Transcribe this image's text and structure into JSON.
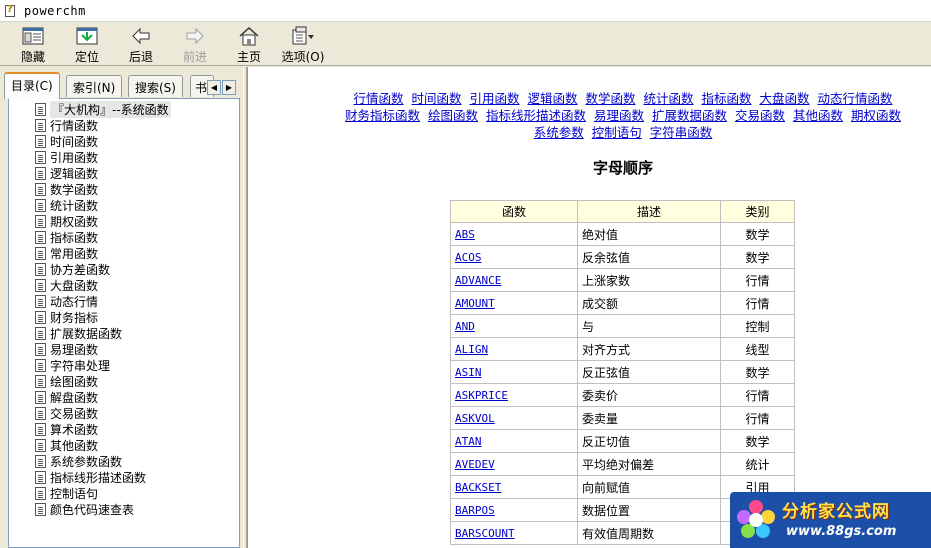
{
  "window": {
    "title": "powerchm"
  },
  "toolbar": {
    "buttons": [
      {
        "label": "隐藏",
        "icon": "hide-icon"
      },
      {
        "label": "定位",
        "icon": "locate-icon"
      },
      {
        "label": "后退",
        "icon": "back-arrow-icon"
      },
      {
        "label": "前进",
        "icon": "forward-arrow-icon",
        "disabled": true
      },
      {
        "label": "主页",
        "icon": "home-icon"
      },
      {
        "label": "选项(O)",
        "icon": "options-icon"
      }
    ]
  },
  "tabs": [
    {
      "label": "目录(C)",
      "active": true
    },
    {
      "label": "索引(N)"
    },
    {
      "label": "搜索(S)"
    },
    {
      "label": "书"
    }
  ],
  "tree": {
    "items": [
      "『大机构』--系统函数",
      "行情函数",
      "时间函数",
      "引用函数",
      "逻辑函数",
      "数学函数",
      "统计函数",
      "期权函数",
      "指标函数",
      "常用函数",
      "协方差函数",
      "大盘函数",
      "动态行情",
      "财务指标",
      "扩展数据函数",
      "易理函数",
      "字符串处理",
      "绘图函数",
      "解盘函数",
      "交易函数",
      "算术函数",
      "其他函数",
      "系统参数函数",
      "指标线形描述函数",
      "控制语句",
      "颜色代码速查表"
    ]
  },
  "content": {
    "category_links": [
      "行情函数",
      "时间函数",
      "引用函数",
      "逻辑函数",
      "数学函数",
      "统计函数",
      "指标函数",
      "大盘函数",
      "动态行情函数",
      "财务指标函数",
      "绘图函数",
      "指标线形描述函数",
      "易理函数",
      "扩展数据函数",
      "交易函数",
      "其他函数",
      "期权函数",
      "系统参数",
      "控制语句",
      "字符串函数"
    ],
    "heading": "字母顺序",
    "table": {
      "headers": [
        "函数",
        "描述",
        "类别"
      ],
      "rows": [
        [
          "ABS",
          "绝对值",
          "数学"
        ],
        [
          "ACOS",
          "反余弦值",
          "数学"
        ],
        [
          "ADVANCE",
          "上涨家数",
          "行情"
        ],
        [
          "AMOUNT",
          "成交额",
          "行情"
        ],
        [
          "AND",
          "与",
          "控制"
        ],
        [
          "ALIGN",
          "对齐方式",
          "线型"
        ],
        [
          "ASIN",
          "反正弦值",
          "数学"
        ],
        [
          "ASKPRICE",
          "委卖价",
          "行情"
        ],
        [
          "ASKVOL",
          "委卖量",
          "行情"
        ],
        [
          "ATAN",
          "反正切值",
          "数学"
        ],
        [
          "AVEDEV",
          "平均绝对偏差",
          "统计"
        ],
        [
          "BACKSET",
          "向前赋值",
          "引用"
        ],
        [
          "BARPOS",
          "数据位置",
          ""
        ],
        [
          "BARSCOUNT",
          "有效值周期数",
          ""
        ]
      ]
    }
  },
  "watermark": {
    "title": "分析家公式网",
    "url": "www.88gs.com"
  }
}
